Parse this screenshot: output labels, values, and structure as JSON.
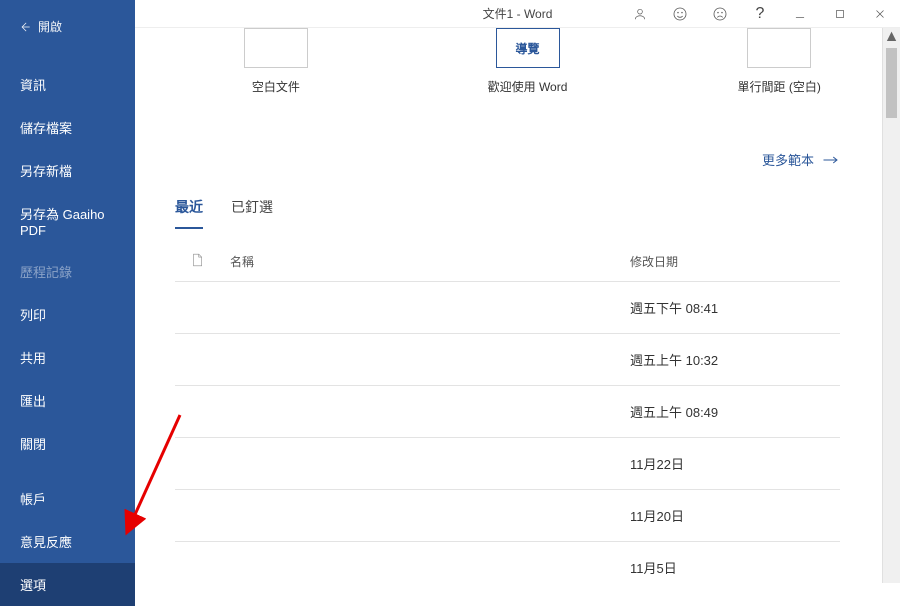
{
  "titlebar": {
    "title": "文件1 - Word"
  },
  "sidebar": {
    "back_label": "開啟",
    "items_top": [
      {
        "label": "資訊"
      },
      {
        "label": "儲存檔案"
      },
      {
        "label": "另存新檔"
      },
      {
        "label": "另存為 Gaaiho PDF"
      },
      {
        "label": "歷程記錄",
        "disabled": true
      },
      {
        "label": "列印"
      },
      {
        "label": "共用"
      },
      {
        "label": "匯出"
      },
      {
        "label": "關閉"
      }
    ],
    "items_bottom": [
      {
        "label": "帳戶"
      },
      {
        "label": "意見反應"
      },
      {
        "label": "選項",
        "active": true
      }
    ]
  },
  "templates": {
    "items": [
      {
        "label": "空白文件",
        "thumb_text": ""
      },
      {
        "label": "歡迎使用 Word",
        "thumb_text": "導覽"
      },
      {
        "label": "單行間距 (空白)",
        "thumb_text": ""
      }
    ],
    "more_label": "更多範本"
  },
  "tabs": {
    "recent": "最近",
    "pinned": "已釘選"
  },
  "list_header": {
    "name": "名稱",
    "date": "修改日期"
  },
  "recent_files": [
    {
      "date": "週五下午 08:41"
    },
    {
      "date": "週五上午 10:32"
    },
    {
      "date": "週五上午 08:49"
    },
    {
      "date": "11月22日"
    },
    {
      "date": "11月20日"
    },
    {
      "date": "11月5日"
    }
  ]
}
